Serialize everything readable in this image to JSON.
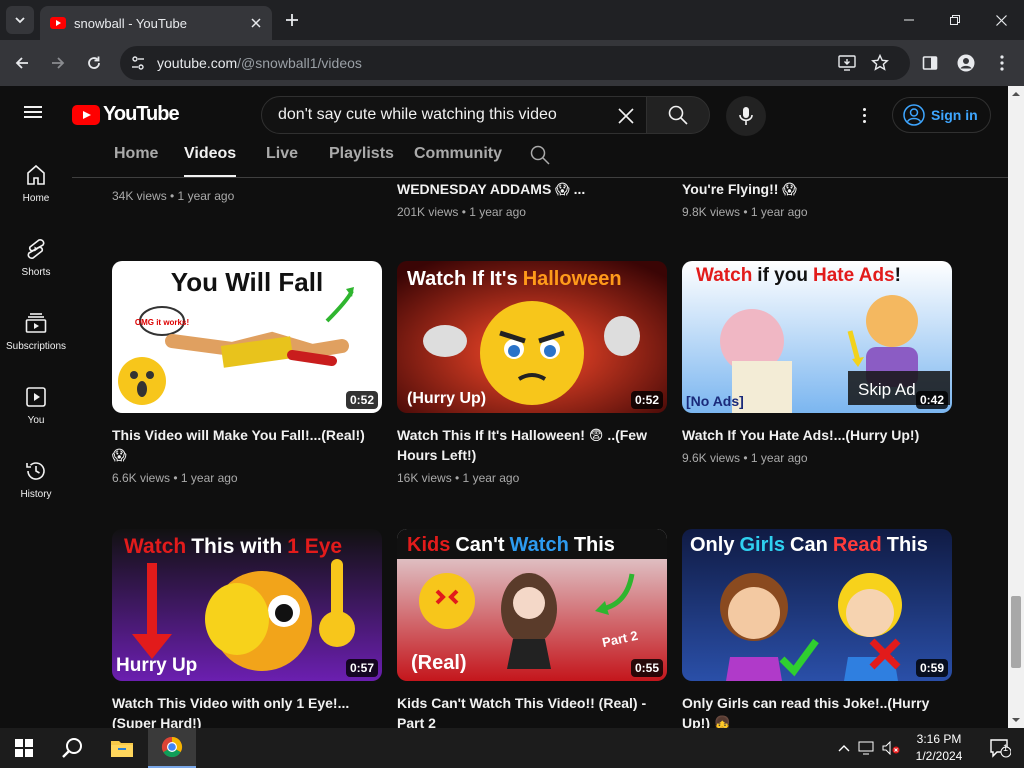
{
  "browser": {
    "tab_title": "snowball - YouTube",
    "url_host": "youtube.com",
    "url_path": "/@snowball1/videos",
    "icons": [
      "tab-search-icon",
      "youtube-favicon",
      "close-icon",
      "new-tab-icon",
      "minimize-icon",
      "maximize-icon",
      "close-window-icon",
      "back-icon",
      "forward-icon",
      "reload-icon",
      "site-info-icon",
      "install-app-icon",
      "bookmark-star-icon",
      "side-panel-icon",
      "profile-icon",
      "chrome-menu-icon"
    ]
  },
  "youtube": {
    "logo_text": "YouTube",
    "search_query": "don't say cute while watching this video",
    "sign_in_label": "Sign in",
    "sidebar": [
      {
        "label": "Home",
        "icon": "home-icon"
      },
      {
        "label": "Shorts",
        "icon": "shorts-icon"
      },
      {
        "label": "Subscriptions",
        "icon": "subscriptions-icon"
      },
      {
        "label": "You",
        "icon": "you-icon"
      },
      {
        "label": "History",
        "icon": "history-icon"
      }
    ],
    "channel_tabs": [
      {
        "label": "Home",
        "active": false
      },
      {
        "label": "Videos",
        "active": true
      },
      {
        "label": "Live",
        "active": false
      },
      {
        "label": "Playlists",
        "active": false
      },
      {
        "label": "Community",
        "active": false
      }
    ],
    "partial_row": [
      {
        "title": "",
        "meta": "34K views • 1 year ago"
      },
      {
        "title": "WEDNESDAY ADDAMS 😱 ...",
        "meta": "201K views • 1 year ago"
      },
      {
        "title": "You're Flying!! 😱",
        "meta": "9.8K views • 1 year ago"
      }
    ],
    "videos": [
      {
        "thumb_text": "You Will Fall",
        "badge": "OMG it works!",
        "duration": "0:52",
        "title": "This Video will Make You Fall!...(Real!) 😱",
        "meta": "6.6K views • 1 year ago"
      },
      {
        "thumb_text_a": "Watch If It's",
        "thumb_text_b": "Halloween",
        "caption": "(Hurry Up)",
        "duration": "0:52",
        "title": "Watch This If It's Halloween! 😨 ..(Few Hours Left!)",
        "meta": "16K views • 1 year ago"
      },
      {
        "thumb_text_a": "Watch",
        "thumb_text_b": "if you",
        "thumb_text_c": "Hate Ads",
        "thumb_text_d": "!",
        "caption": "[No Ads]",
        "skip_text": "Skip Ad",
        "duration": "0:42",
        "title": "Watch If You Hate Ads!...(Hurry Up!)",
        "meta": "9.6K views • 1 year ago"
      },
      {
        "thumb_text_a": "Watch",
        "thumb_text_b": "This with",
        "thumb_text_c": "1 Eye",
        "caption": "Hurry Up",
        "duration": "0:57",
        "title": "Watch This Video with only 1 Eye!... (Super Hard!)",
        "meta": ""
      },
      {
        "thumb_text_a": "Kids",
        "thumb_text_b": "Can't",
        "thumb_text_c": "Watch",
        "thumb_text_d": "This",
        "caption": "(Real)",
        "part": "Part 2",
        "duration": "0:55",
        "title": "Kids Can't Watch This Video!! (Real) - Part 2",
        "meta": ""
      },
      {
        "thumb_text_a": "Only",
        "thumb_text_b": "Girls",
        "thumb_text_c": "Can",
        "thumb_text_d": "Read",
        "thumb_text_e": "This",
        "duration": "0:59",
        "title": "Only Girls can read this Joke!..(Hurry Up!) 👧",
        "meta": ""
      }
    ]
  },
  "taskbar": {
    "time": "3:16 PM",
    "date": "1/2/2024",
    "notification_count": "1",
    "apps": [
      "windows-start-icon",
      "search-icon",
      "file-explorer-icon",
      "chrome-icon"
    ]
  }
}
